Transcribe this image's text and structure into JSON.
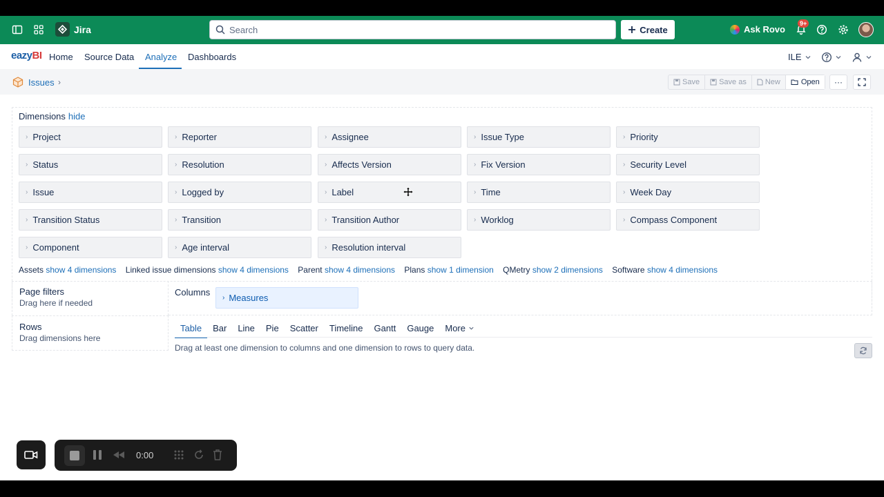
{
  "jira": {
    "app_name": "Jira",
    "search_placeholder": "Search",
    "create_label": "Create",
    "ask_rovo_label": "Ask Rovo",
    "notif_badge": "9+"
  },
  "nav": {
    "logo_part1": "eazy",
    "logo_part2": "BI",
    "items": [
      "Home",
      "Source Data",
      "Analyze",
      "Dashboards"
    ],
    "active": "Analyze",
    "lang": "ILE"
  },
  "breadcrumb": {
    "label": "Issues"
  },
  "toolbar": {
    "save": "Save",
    "save_as": "Save as",
    "new": "New",
    "open": "Open",
    "more": "···"
  },
  "dimensions": {
    "title": "Dimensions",
    "hide_label": "hide",
    "chips": [
      "Project",
      "Reporter",
      "Assignee",
      "Issue Type",
      "Priority",
      "Status",
      "Resolution",
      "Affects Version",
      "Fix Version",
      "Security Level",
      "Issue",
      "Logged by",
      "Label",
      "Time",
      "Week Day",
      "Transition Status",
      "Transition",
      "Transition Author",
      "Worklog",
      "Compass Component",
      "Component",
      "Age interval",
      "Resolution interval"
    ],
    "groups": [
      {
        "name": "Assets",
        "link": "show 4 dimensions"
      },
      {
        "name": "Linked issue dimensions",
        "link": "show 4 dimensions"
      },
      {
        "name": "Parent",
        "link": "show 4 dimensions"
      },
      {
        "name": "Plans",
        "link": "show 1 dimension"
      },
      {
        "name": "QMetry",
        "link": "show 2 dimensions"
      },
      {
        "name": "Software",
        "link": "show 4 dimensions"
      }
    ]
  },
  "page_filters": {
    "title": "Page filters",
    "hint": "Drag here if needed"
  },
  "rows": {
    "title": "Rows",
    "hint": "Drag dimensions here"
  },
  "columns": {
    "label": "Columns",
    "chip": "Measures"
  },
  "chart_tabs": {
    "items": [
      "Table",
      "Bar",
      "Line",
      "Pie",
      "Scatter",
      "Timeline",
      "Gantt",
      "Gauge"
    ],
    "more": "More",
    "active": "Table"
  },
  "hint_text": "Drag at least one dimension to columns and one dimension to rows to query data.",
  "recorder": {
    "time": "0:00"
  }
}
